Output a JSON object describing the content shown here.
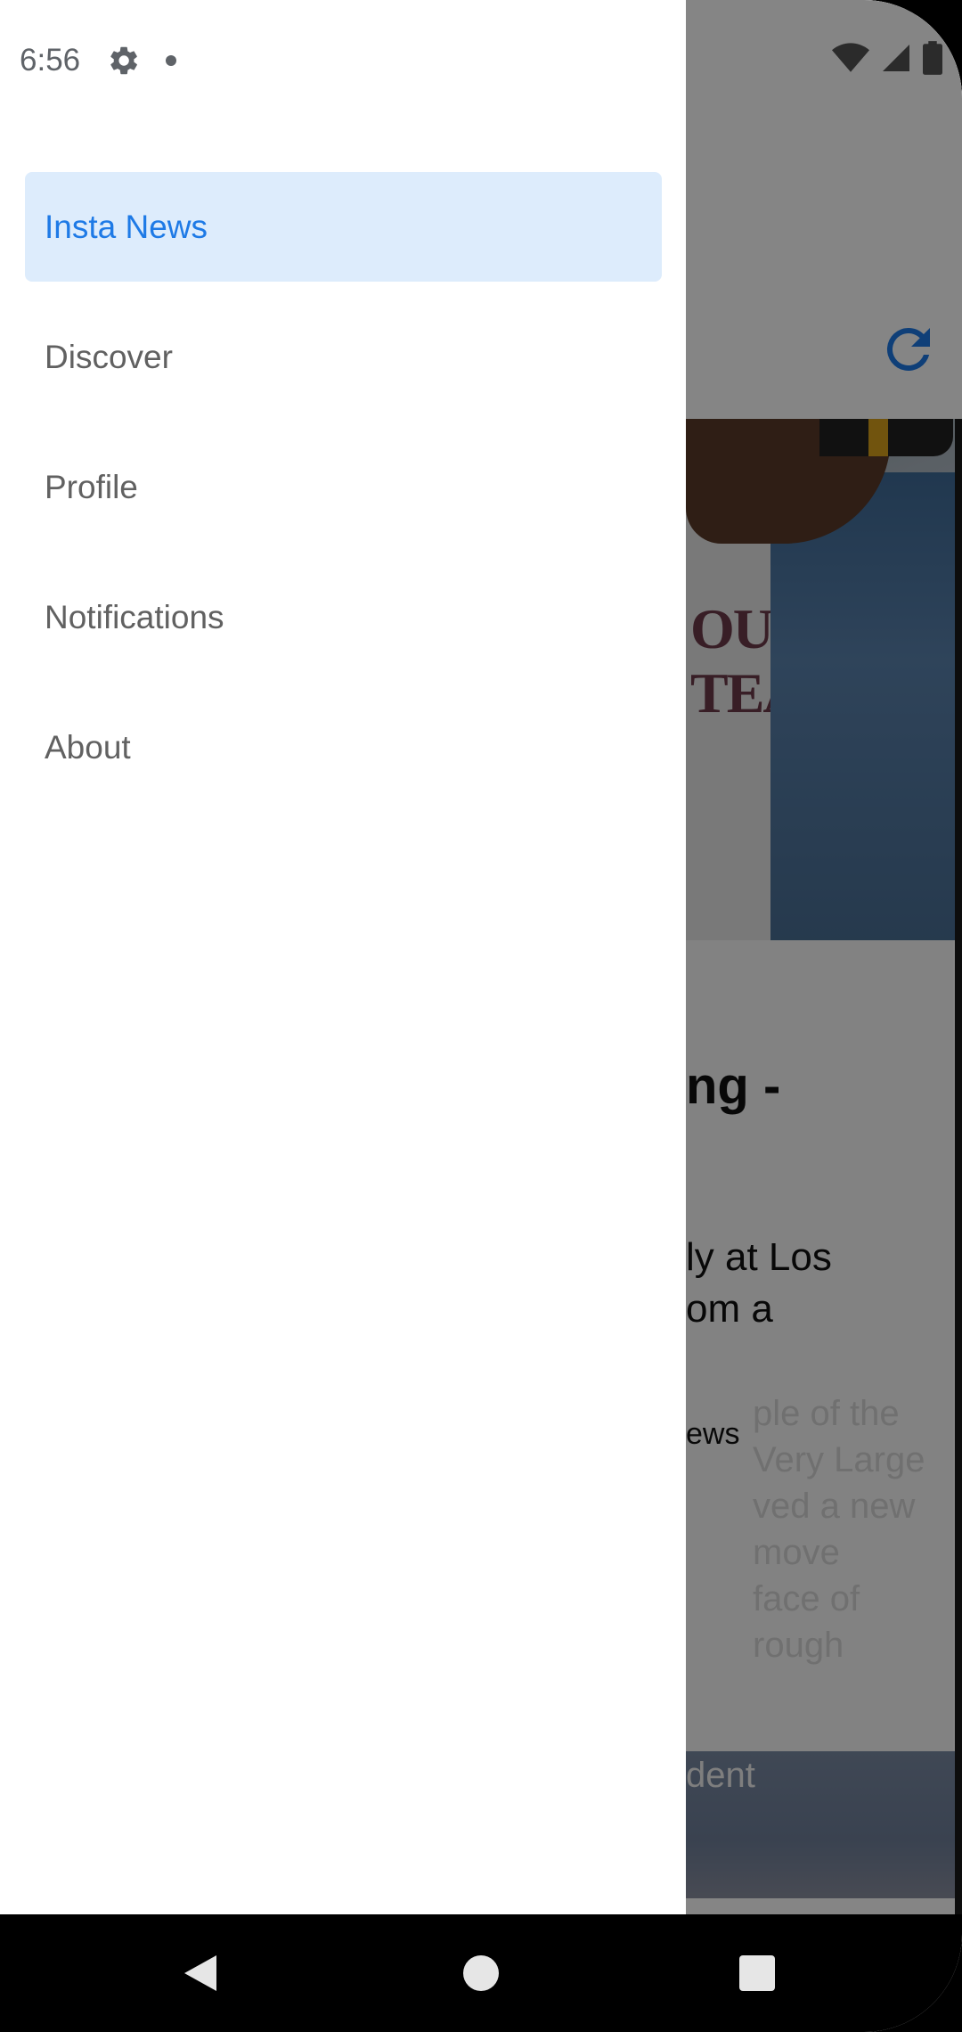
{
  "status_bar": {
    "time": "6:56",
    "icons_left": [
      "gear-icon",
      "notification-dot-icon"
    ],
    "icons_right": [
      "wifi-icon",
      "cellular-signal-icon",
      "battery-icon"
    ]
  },
  "drawer": {
    "items": [
      {
        "label": "Insta News",
        "active": true
      },
      {
        "label": "Discover",
        "active": false
      },
      {
        "label": "Profile",
        "active": false
      },
      {
        "label": "Notifications",
        "active": false
      },
      {
        "label": "About",
        "active": false
      }
    ],
    "active_color": "#1e7ae6",
    "active_bg": "#ddecfc"
  },
  "background_app": {
    "refresh_icon": "refresh-icon",
    "hero_print": [
      "OUSI",
      "TEAM"
    ],
    "article_title_partial": "ng -",
    "article_desc_partial": [
      "ly at Los",
      "om a"
    ],
    "article_source_partial": "ews",
    "faded_text": [
      "ple of the",
      "Very Large",
      "ved a new",
      "move",
      "face of",
      "rough"
    ],
    "next_card_text": "dent"
  },
  "nav_bar": {
    "icons": [
      "back-icon",
      "home-icon",
      "recents-icon"
    ]
  }
}
